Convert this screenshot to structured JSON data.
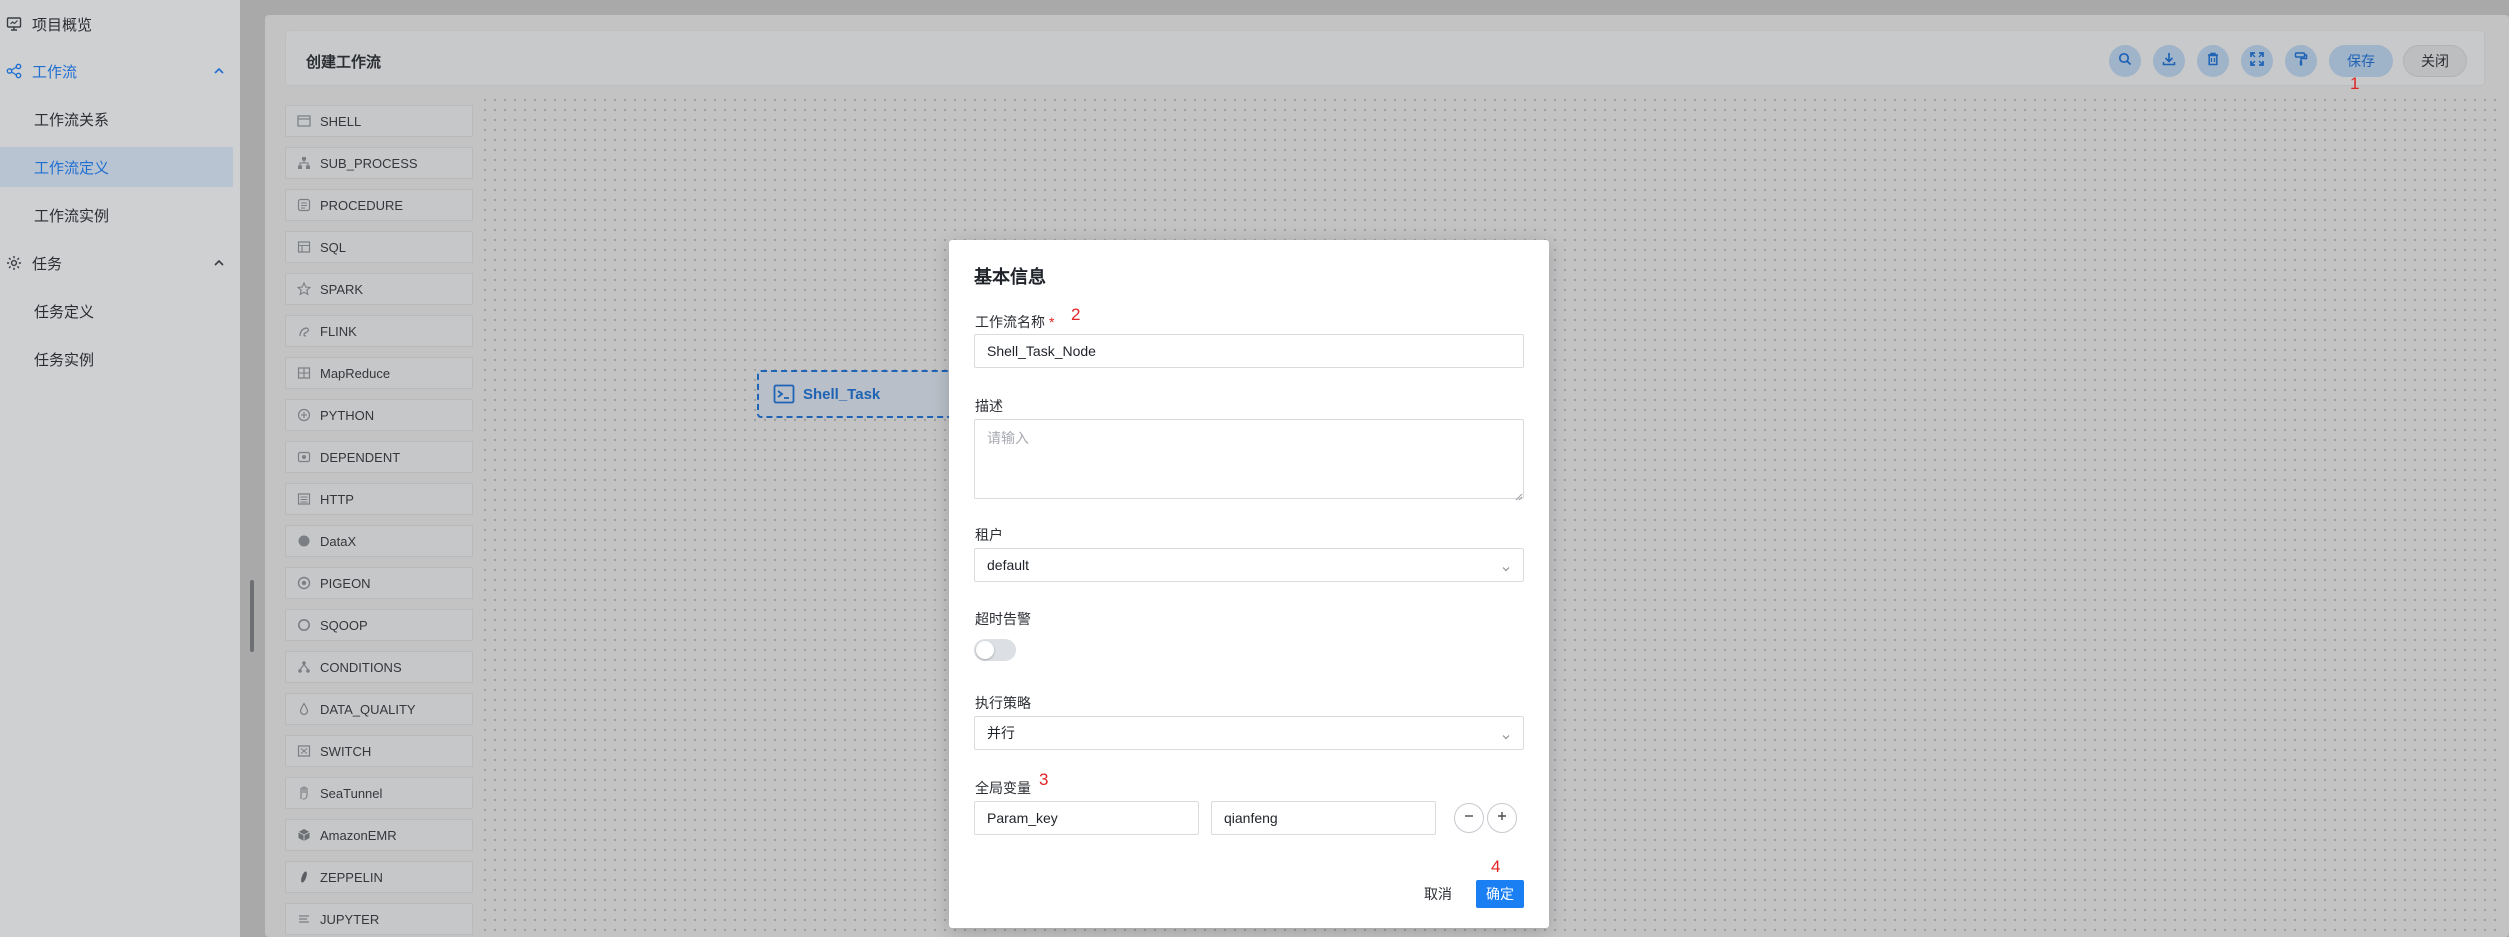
{
  "sidebar": {
    "items": [
      {
        "label": "项目概览",
        "icon": "monitor-icon"
      },
      {
        "label": "工作流",
        "icon": "workflow-icon"
      },
      {
        "label": "工作流关系"
      },
      {
        "label": "工作流定义"
      },
      {
        "label": "工作流实例"
      },
      {
        "label": "任务",
        "icon": "gear-icon"
      },
      {
        "label": "任务定义"
      },
      {
        "label": "任务实例"
      }
    ]
  },
  "header": {
    "title": "创建工作流",
    "save_label": "保存",
    "close_label": "关闭",
    "icons": [
      "search-icon",
      "download-icon",
      "delete-icon",
      "fullscreen-icon",
      "format-icon"
    ]
  },
  "tasks": [
    "SHELL",
    "SUB_PROCESS",
    "PROCEDURE",
    "SQL",
    "SPARK",
    "FLINK",
    "MapReduce",
    "PYTHON",
    "DEPENDENT",
    "HTTP",
    "DataX",
    "PIGEON",
    "SQOOP",
    "CONDITIONS",
    "DATA_QUALITY",
    "SWITCH",
    "SeaTunnel",
    "AmazonEMR",
    "ZEPPELIN",
    "JUPYTER"
  ],
  "canvas": {
    "node_label": "Shell_Task"
  },
  "annotations": [
    "1",
    "2",
    "3",
    "4"
  ],
  "modal": {
    "title": "基本信息",
    "name_label": "工作流名称",
    "required_mark": "*",
    "name_value": "Shell_Task_Node",
    "desc_label": "描述",
    "desc_placeholder": "请输入",
    "tenant_label": "租户",
    "tenant_value": "default",
    "timeout_label": "超时告警",
    "timeout_enabled": false,
    "strategy_label": "执行策略",
    "strategy_value": "并行",
    "global_vars_label": "全局变量",
    "global_var_key": "Param_key",
    "global_var_value": "qianfeng",
    "cancel_label": "取消",
    "confirm_label": "确定"
  },
  "colors": {
    "accent": "#1a7ff2",
    "annotation": "#e02424",
    "overlay": "#a9a9a9"
  }
}
